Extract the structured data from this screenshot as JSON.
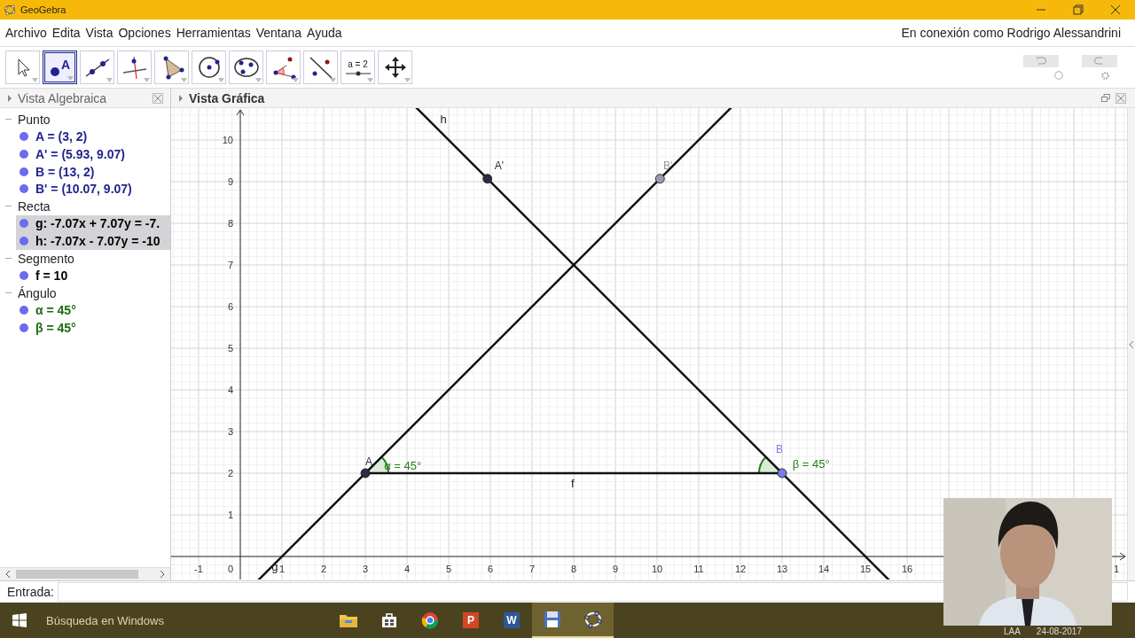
{
  "window": {
    "title": "GeoGebra"
  },
  "menu": [
    "Archivo",
    "Edita",
    "Vista",
    "Opciones",
    "Herramientas",
    "Ventana",
    "Ayuda"
  ],
  "account": "En conexión como Rodrigo Alessandrini",
  "tools": [
    {
      "kind": "move",
      "selected": false
    },
    {
      "kind": "point",
      "label": "A",
      "selected": true
    },
    {
      "kind": "line",
      "selected": false
    },
    {
      "kind": "perpendicular",
      "selected": false
    },
    {
      "kind": "polygon",
      "selected": false
    },
    {
      "kind": "circle",
      "selected": false
    },
    {
      "kind": "conic",
      "selected": false
    },
    {
      "kind": "angle",
      "selected": false
    },
    {
      "kind": "reflect",
      "selected": false
    },
    {
      "kind": "slider",
      "label": "a = 2",
      "selected": false
    },
    {
      "kind": "move-view",
      "selected": false
    }
  ],
  "algebra_view": {
    "title": "Vista Algebraica",
    "groups": [
      {
        "name": "Punto",
        "expanded": true,
        "children": [
          {
            "text": "A = (3, 2)",
            "color": "#23238f",
            "selected": false
          },
          {
            "text": "A' = (5.93, 9.07)",
            "color": "#23238f",
            "selected": false
          },
          {
            "text": "B = (13, 2)",
            "color": "#23238f",
            "selected": false
          },
          {
            "text": "B' = (10.07, 9.07)",
            "color": "#23238f",
            "selected": false
          }
        ]
      },
      {
        "name": "Recta",
        "expanded": true,
        "children": [
          {
            "text": "g: -7.07x + 7.07y = -7.",
            "color": "#000000",
            "selected": true
          },
          {
            "text": "h: -7.07x - 7.07y = -10",
            "color": "#000000",
            "selected": true
          }
        ]
      },
      {
        "name": "Segmento",
        "expanded": true,
        "children": [
          {
            "text": "f = 10",
            "color": "#000000",
            "selected": false
          }
        ]
      },
      {
        "name": "Ángulo",
        "expanded": true,
        "children": [
          {
            "text": "α = 45°",
            "color": "#1e6b12",
            "selected": false
          },
          {
            "text": "β = 45°",
            "color": "#1e6b12",
            "selected": false
          }
        ]
      }
    ]
  },
  "graphics_view": {
    "title": "Vista Gráfica",
    "x_ticks": [
      "-1",
      "0",
      "1",
      "2",
      "3",
      "4",
      "5",
      "6",
      "7",
      "8",
      "9",
      "10",
      "11",
      "12",
      "13",
      "14",
      "15",
      "16"
    ],
    "x_edge_label": "1",
    "y_ticks": [
      "10",
      "9",
      "8",
      "7",
      "6",
      "5",
      "4",
      "3",
      "2",
      "1"
    ],
    "lines": [
      {
        "label": "g"
      },
      {
        "label": "h"
      }
    ],
    "segment": {
      "label": "f"
    },
    "points": [
      {
        "label": "A",
        "color": "#2c2c4a"
      },
      {
        "label": "A'",
        "color": "#2c2c4a"
      },
      {
        "label": "B",
        "color": "#7b7be6"
      },
      {
        "label": "B'",
        "color": "#9a9aaa"
      }
    ],
    "angles": [
      {
        "label": "α = 45°"
      },
      {
        "label": "β = 45°"
      }
    ]
  },
  "input_bar": {
    "label": "Entrada:"
  },
  "taskbar": {
    "search_placeholder": "Búsqueda en Windows",
    "apps": [
      {
        "kind": "folder",
        "selected": false
      },
      {
        "kind": "store",
        "selected": false
      },
      {
        "kind": "browser",
        "selected": false
      },
      {
        "kind": "slides",
        "label": "P",
        "selected": false
      },
      {
        "kind": "document",
        "label": "W",
        "selected": false
      },
      {
        "kind": "disk",
        "selected": true
      },
      {
        "kind": "geogebra",
        "selected": true
      }
    ],
    "tray": [
      "LAA",
      "24-08-2017"
    ]
  }
}
